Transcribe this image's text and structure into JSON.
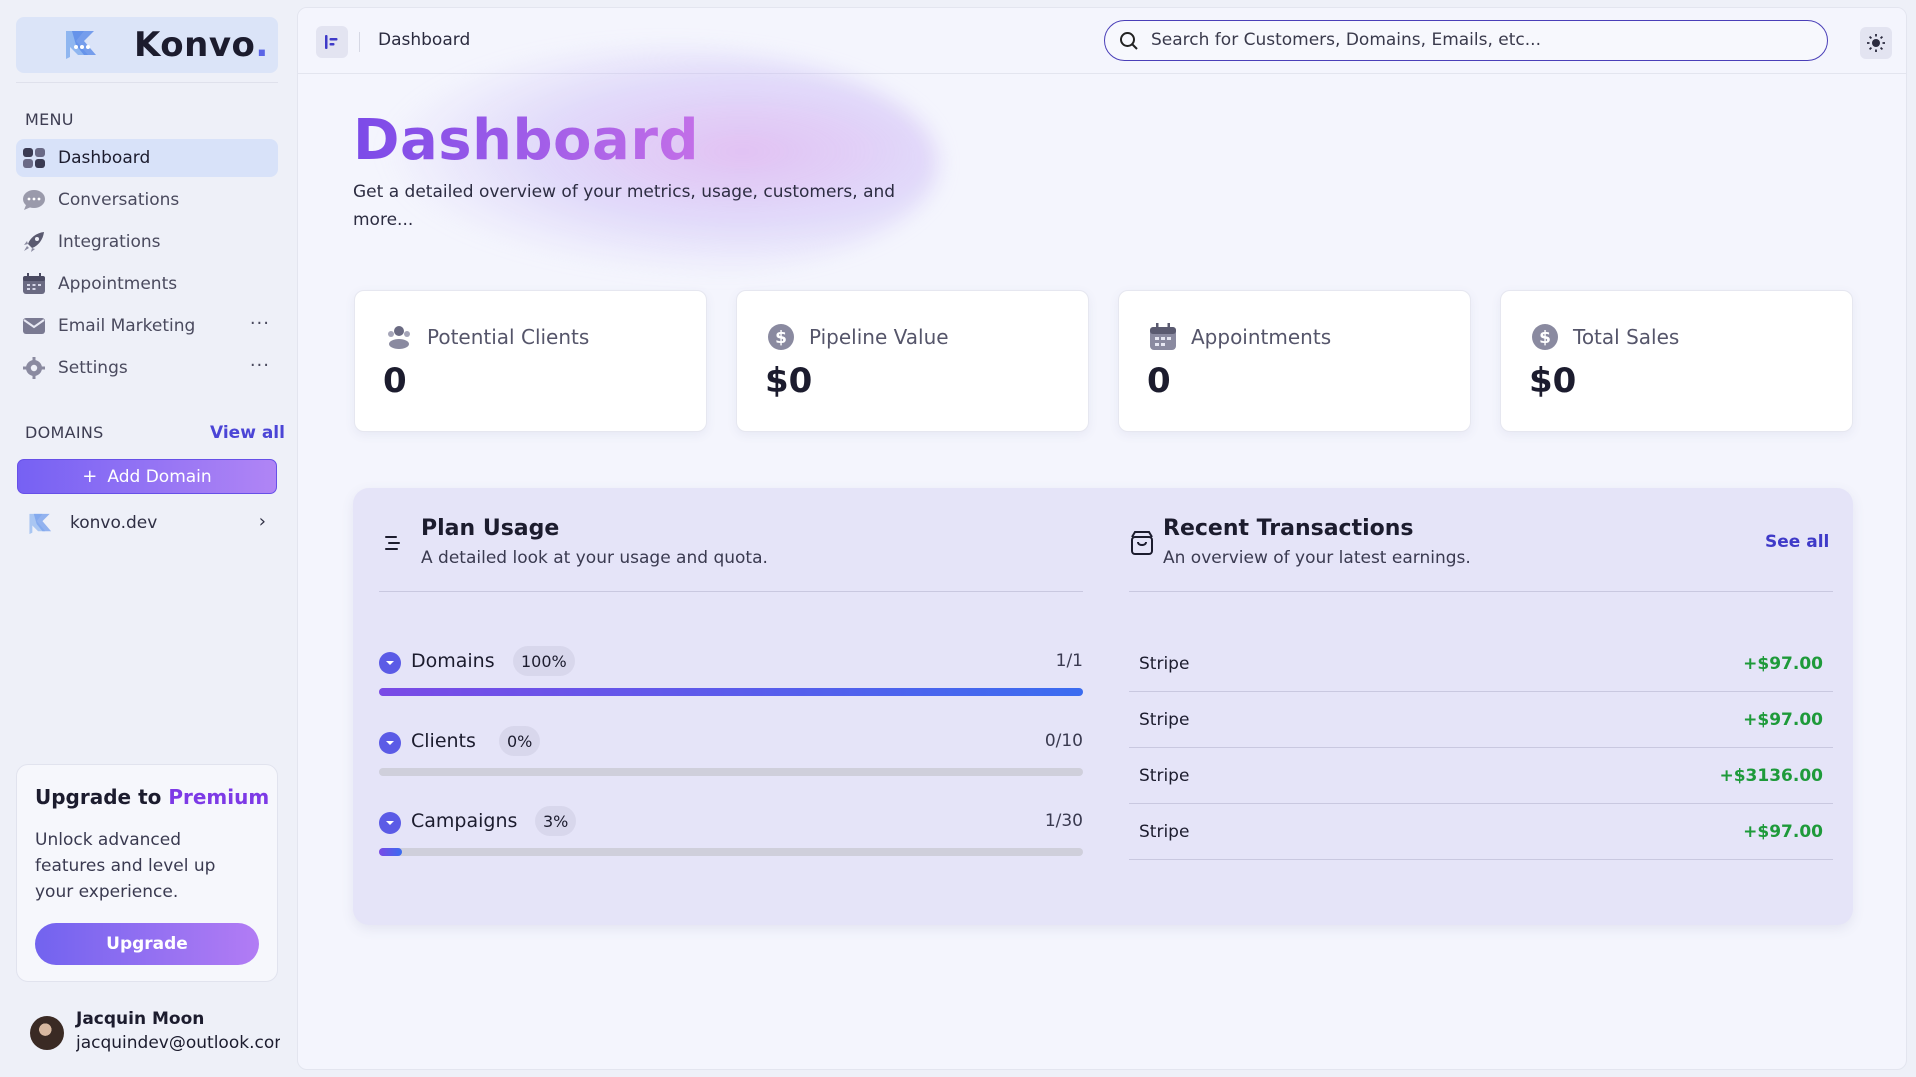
{
  "brand": {
    "name": "Konvo",
    "dot": "."
  },
  "sidebar": {
    "menu_label": "MENU",
    "items": [
      {
        "label": "Dashboard",
        "icon": "grid-icon",
        "active": true
      },
      {
        "label": "Conversations",
        "icon": "chat-bubble-icon"
      },
      {
        "label": "Integrations",
        "icon": "rocket-icon"
      },
      {
        "label": "Appointments",
        "icon": "calendar-icon"
      },
      {
        "label": "Email Marketing",
        "icon": "envelope-icon",
        "more": "···"
      },
      {
        "label": "Settings",
        "icon": "gear-icon",
        "more": "···"
      }
    ],
    "domains_label": "DOMAINS",
    "view_all": "View all",
    "add_domain": "Add Domain",
    "add_symbol": "+",
    "domains": [
      {
        "label": "konvo.dev",
        "chevron": "›"
      }
    ],
    "upgrade": {
      "title_prefix": "Upgrade to ",
      "title_highlight": "Premium",
      "text": "Unlock advanced features and level up your experience.",
      "button": "Upgrade"
    },
    "user": {
      "name": "Jacquin Moon",
      "email": "jacquindev@outlook.com"
    }
  },
  "topbar": {
    "breadcrumb": "Dashboard",
    "search_placeholder": "Search for Customers, Domains, Emails, etc..."
  },
  "header": {
    "title": "Dashboard",
    "subtitle": "Get a detailed overview of your metrics, usage, customers, and more..."
  },
  "stats": [
    {
      "label": "Potential Clients",
      "value": "0",
      "icon": "users-icon"
    },
    {
      "label": "Pipeline Value",
      "value": "$0",
      "icon": "dollar-icon"
    },
    {
      "label": "Appointments",
      "value": "0",
      "icon": "calendar-icon"
    },
    {
      "label": "Total Sales",
      "value": "$0",
      "icon": "dollar-icon"
    }
  ],
  "plan_usage": {
    "title": "Plan Usage",
    "subtitle": "A detailed look at your usage and quota.",
    "rows": [
      {
        "name": "Domains",
        "percent": "100%",
        "count": "1/1",
        "fill": 1.0
      },
      {
        "name": "Clients",
        "percent": "0%",
        "count": "0/10",
        "fill": 0.0
      },
      {
        "name": "Campaigns",
        "percent": "3%",
        "count": "1/30",
        "fill": 0.033
      }
    ]
  },
  "transactions": {
    "title": "Recent Transactions",
    "subtitle": "An overview of your latest earnings.",
    "see_all": "See all",
    "rows": [
      {
        "name": "Stripe",
        "amount": "+$97.00"
      },
      {
        "name": "Stripe",
        "amount": "+$97.00"
      },
      {
        "name": "Stripe",
        "amount": "+$3136.00"
      },
      {
        "name": "Stripe",
        "amount": "+$97.00"
      }
    ]
  },
  "colors": {
    "accent": "#7661f3",
    "positive": "#1e9a3a",
    "premium": "#7d3ae6"
  }
}
